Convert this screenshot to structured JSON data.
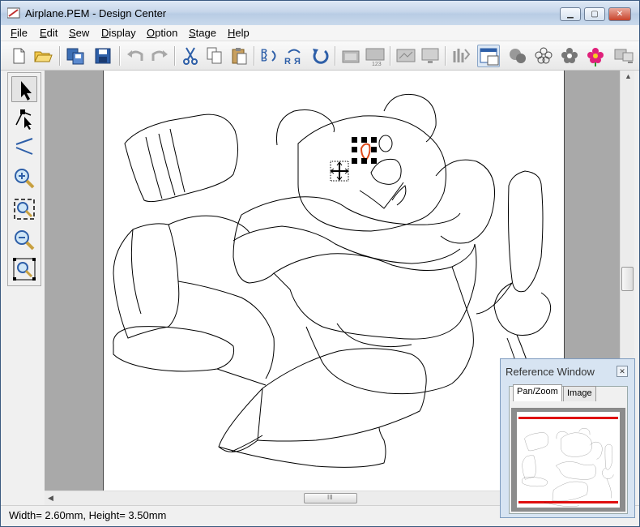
{
  "window": {
    "title": "Airplane.PEM - Design Center",
    "minimize": "▁",
    "maximize": "▢",
    "close": "✕"
  },
  "menu": [
    {
      "label": "File",
      "underline": "F",
      "rest": "ile"
    },
    {
      "label": "Edit",
      "underline": "E",
      "rest": "dit"
    },
    {
      "label": "Sew",
      "underline": "S",
      "rest": "ew"
    },
    {
      "label": "Display",
      "underline": "D",
      "rest": "isplay"
    },
    {
      "label": "Option",
      "underline": "O",
      "rest": "ption"
    },
    {
      "label": "Stage",
      "underline": "S",
      "rest": "tage"
    },
    {
      "label": "Help",
      "underline": "H",
      "rest": "elp"
    }
  ],
  "toolbar_icons": [
    "new-file-icon",
    "open-folder-icon",
    "import-icon",
    "save-icon",
    "undo-icon",
    "redo-icon",
    "cut-icon",
    "copy-icon",
    "paste-icon",
    "mirror-horizontal-icon",
    "mirror-vertical-icon",
    "rotate-icon",
    "folder-icon",
    "numbered-icon",
    "slides-icon",
    "monitor-icon",
    "stitch-icon",
    "reference-window-icon",
    "stage-original-icon",
    "stage-line-icon",
    "stage-figure-icon",
    "stage-embroidery-icon",
    "transfer-icon"
  ],
  "left_tools": [
    "select-arrow-icon",
    "point-edit-icon",
    "line-tool-icon",
    "zoom-in-icon",
    "fit-to-page-icon",
    "zoom-out-icon",
    "zoom-real-size-icon"
  ],
  "status": {
    "text": "Width= 2.60mm, Height= 3.50mm"
  },
  "reference_window": {
    "title": "Reference Window",
    "close": "✕",
    "tabs": [
      {
        "label": "Pan/Zoom",
        "active": true
      },
      {
        "label": "Image",
        "active": false
      }
    ]
  },
  "scroll": {
    "up": "▲",
    "down": "▼",
    "left": "◀",
    "right": "▶",
    "grip": "III"
  },
  "colors": {
    "selection_handle": "#000000",
    "selected_outline": "#e04a1a",
    "frame_red": "#e01010"
  }
}
